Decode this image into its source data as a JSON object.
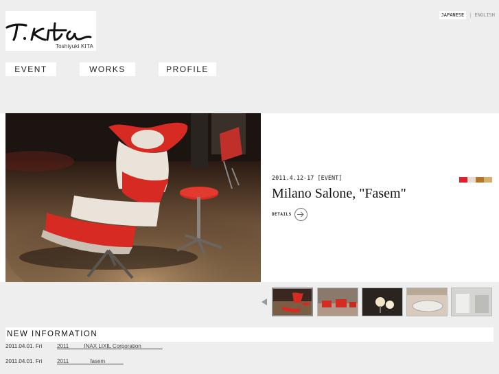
{
  "header": {
    "logo_subtitle": "Toshiyuki KITA",
    "lang_japanese": "JAPANESE",
    "lang_separator": "|",
    "lang_english": "ENGLISH"
  },
  "nav": [
    {
      "label": "EVENT"
    },
    {
      "label": "WORKS"
    },
    {
      "label": "PROFILE"
    }
  ],
  "hero": {
    "date_tag": "2011.4.12-17 [EVENT]",
    "title": "Milano Salone, \"Fasem\"",
    "details_label": "DETAILS",
    "swatch_colors": [
      "#e0202a",
      "#e6dcd4",
      "#b5752a",
      "#d6b06a"
    ]
  },
  "news": {
    "heading": "NEW INFORMATION",
    "items": [
      {
        "date": "2011.04.01. Fri",
        "link": "2011          INAX LIXIL Corporation              "
      },
      {
        "date": "2011.04.01. Fri",
        "link": "2011              fasem            "
      }
    ]
  }
}
